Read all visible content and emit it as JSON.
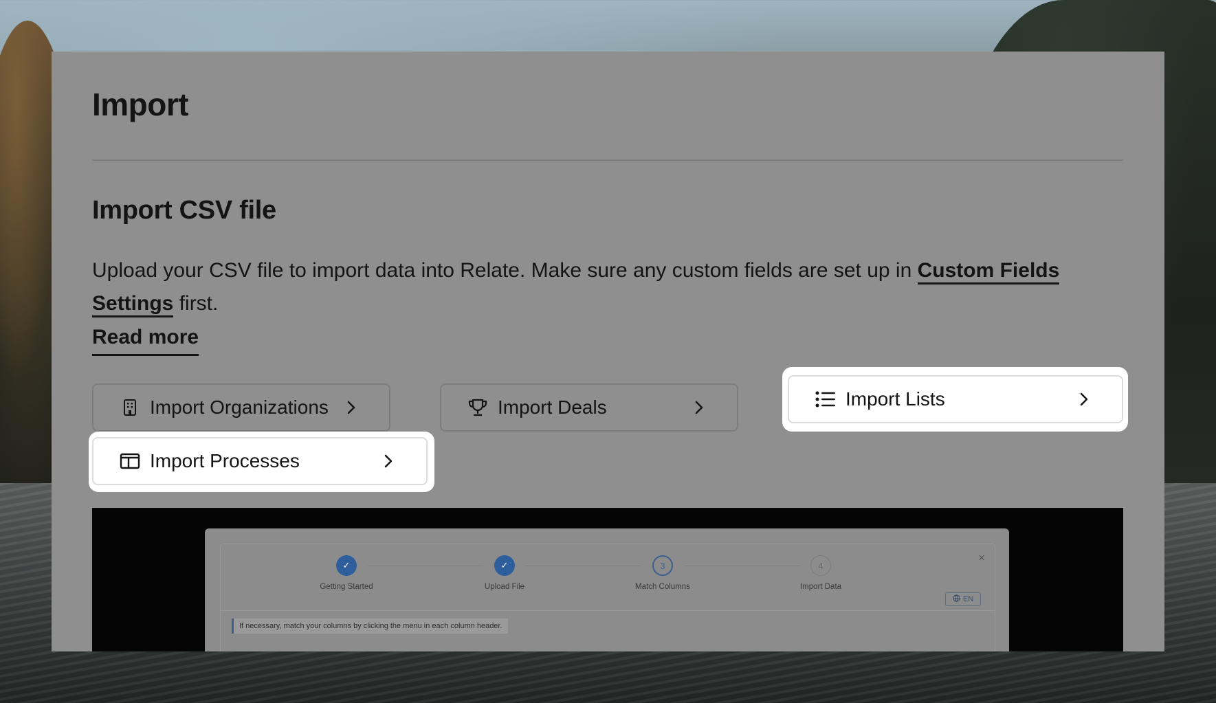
{
  "page": {
    "title": "Import",
    "section_title": "Import CSV file",
    "description_before": "Upload your CSV file to import data into Relate. Make sure any custom fields are set up in ",
    "description_link": "Custom Fields Settings",
    "description_after": " first.",
    "read_more": "Read more"
  },
  "import_buttons": [
    {
      "label": "Import Organizations",
      "icon": "building-icon",
      "highlighted": false
    },
    {
      "label": "Import Deals",
      "icon": "trophy-icon",
      "highlighted": false
    },
    {
      "label": "Import Lists",
      "icon": "list-icon",
      "highlighted": true
    },
    {
      "label": "Import Processes",
      "icon": "columns-icon",
      "highlighted": true
    }
  ],
  "preview": {
    "steps": [
      {
        "label": "Getting Started",
        "marker": "✓",
        "state": "done"
      },
      {
        "label": "Upload File",
        "marker": "✓",
        "state": "done"
      },
      {
        "label": "Match Columns",
        "marker": "3",
        "state": "current"
      },
      {
        "label": "Import Data",
        "marker": "4",
        "state": "todo"
      }
    ],
    "language": "EN",
    "close": "×",
    "hint": "If necessary, match your columns by clicking the menu in each column header."
  }
}
